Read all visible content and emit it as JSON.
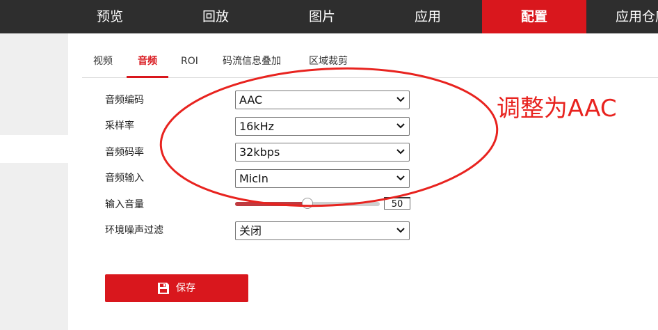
{
  "topnav": {
    "items": [
      {
        "label": "预览"
      },
      {
        "label": "回放"
      },
      {
        "label": "图片"
      },
      {
        "label": "应用"
      },
      {
        "label": "配置"
      },
      {
        "label": "应用仓库"
      }
    ],
    "active_index": 4
  },
  "tabs": [
    {
      "label": "视频"
    },
    {
      "label": "音频"
    },
    {
      "label": "ROI"
    },
    {
      "label": "码流信息叠加"
    },
    {
      "label": "区域裁剪"
    }
  ],
  "form": {
    "audio_encoding": {
      "label": "音频编码",
      "value": "AAC"
    },
    "sample_rate": {
      "label": "采样率",
      "value": "16kHz"
    },
    "audio_bitrate": {
      "label": "音频码率",
      "value": "32kbps"
    },
    "audio_input": {
      "label": "音频输入",
      "value": "MicIn"
    },
    "input_volume": {
      "label": "输入音量",
      "value": "50",
      "fraction": 0.5
    },
    "noise_filter": {
      "label": "环境噪声过滤",
      "value": "关闭"
    }
  },
  "save_button": {
    "label": "保存"
  },
  "annotation": {
    "text": "调整为AAC"
  },
  "colors": {
    "accent": "#d9171d",
    "nav_bg": "#2e2e2e",
    "annotation": "#e8231f"
  },
  "icons": {
    "chevron": "chevron-down-icon",
    "save": "floppy-disk-icon"
  }
}
